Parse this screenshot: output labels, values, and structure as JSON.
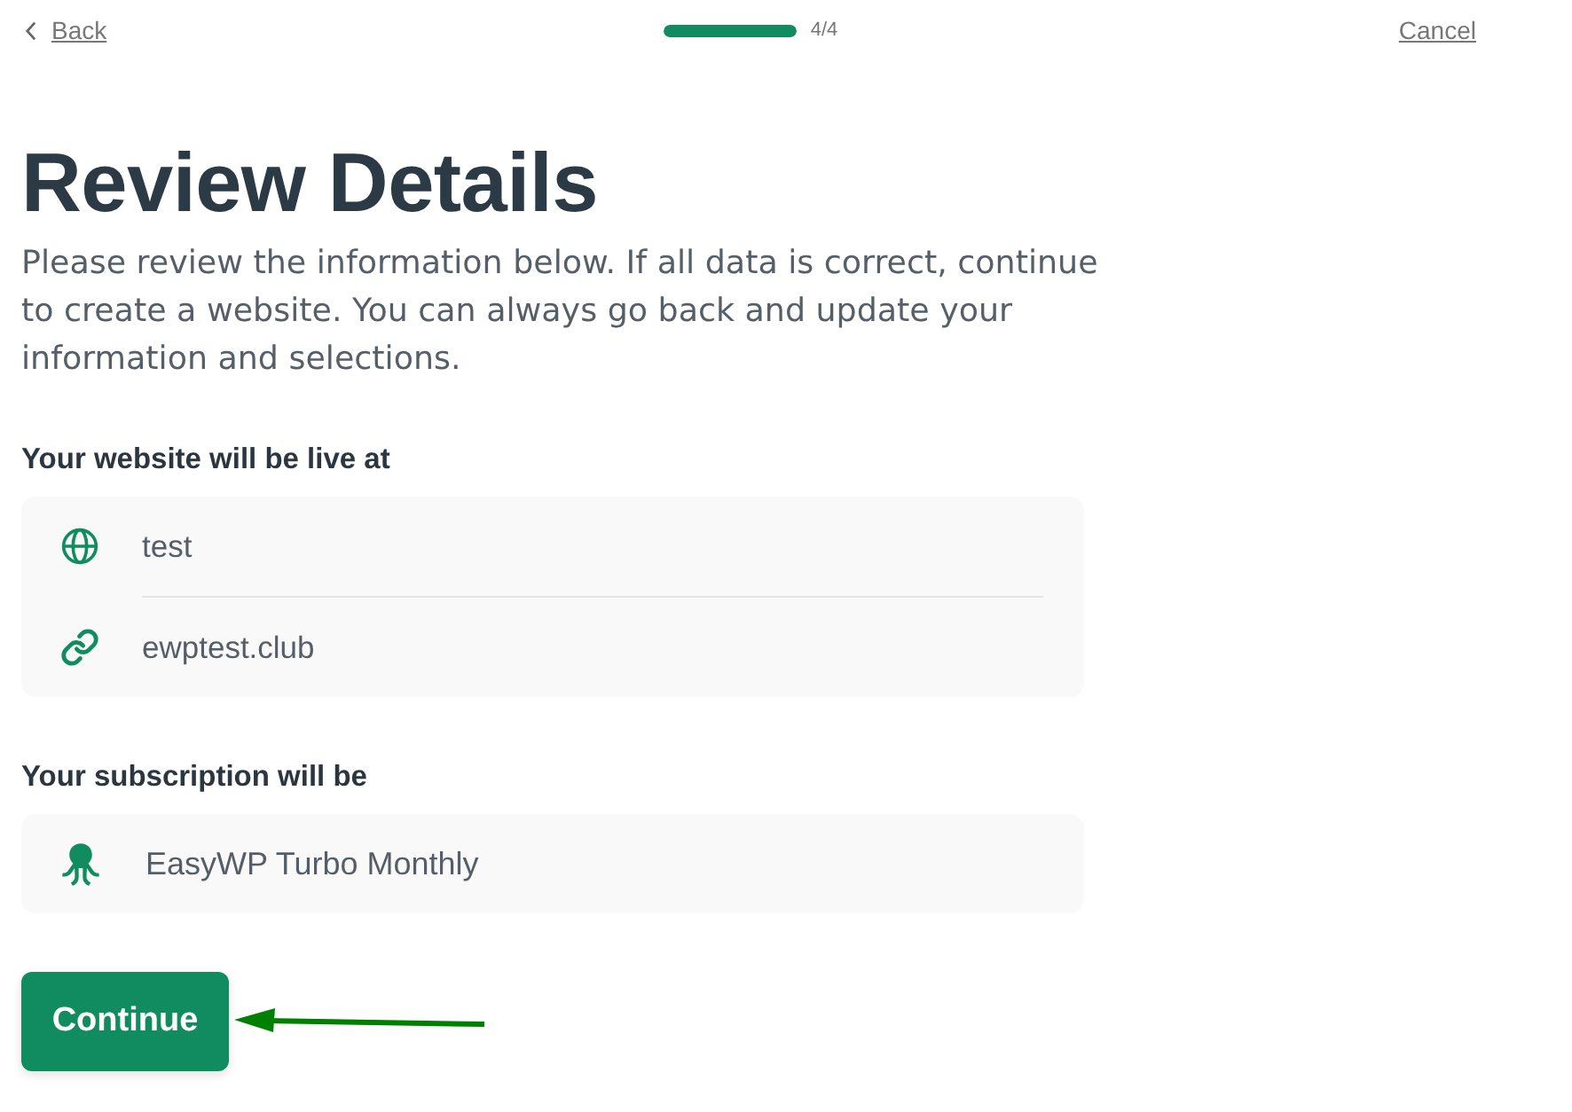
{
  "header": {
    "back": "Back",
    "progress": {
      "level": 1,
      "label": "4/4"
    },
    "cancel": "Cancel"
  },
  "title": "Review Details",
  "intro": "Please review the information below. If all data is correct, continue to create a website. You can always go back and update your information and selections.",
  "sections": [
    {
      "heading": "Your website will be live at",
      "rows": [
        {
          "kind": "globe",
          "text": "test"
        },
        {
          "kind": "link",
          "text": "ewptest.club"
        }
      ]
    },
    {
      "heading": "Your subscription will be",
      "rows": [
        {
          "kind": "octopus",
          "text": "EasyWP Turbo Monthly"
        }
      ]
    }
  ],
  "continue": "Continue"
}
